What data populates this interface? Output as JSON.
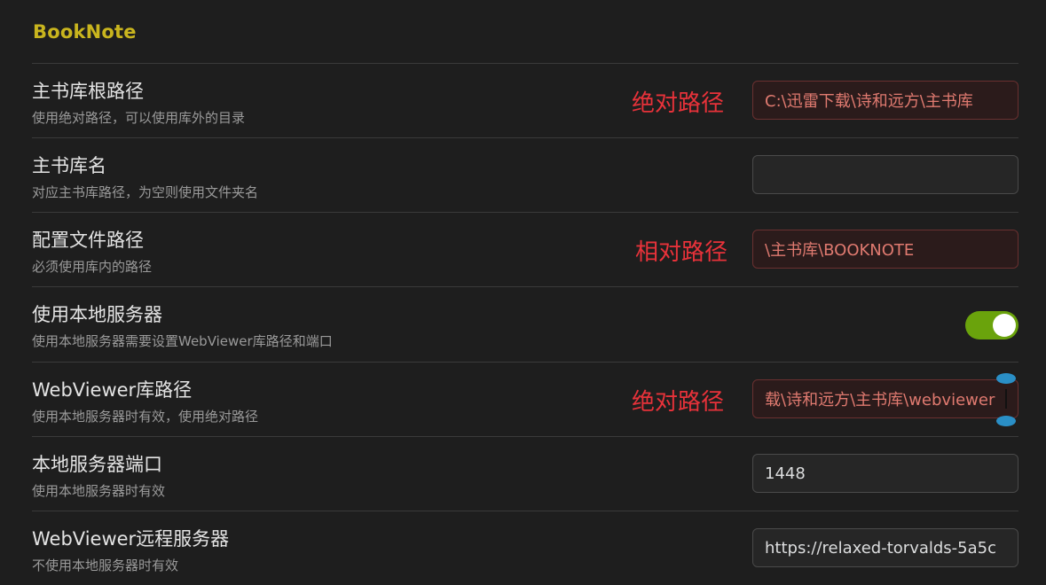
{
  "section": {
    "title": "BookNote"
  },
  "settings": [
    {
      "name": "主书库根路径",
      "desc": "使用绝对路径，可以使用库外的目录",
      "note": "绝对路径",
      "value": "C:\\迅雷下载\\诗和远方\\主书库",
      "placeholder": ""
    },
    {
      "name": "主书库名",
      "desc": "对应主书库路径，为空则使用文件夹名",
      "note": "",
      "value": "",
      "placeholder": ""
    },
    {
      "name": "配置文件路径",
      "desc": "必须使用库内的路径",
      "note": "相对路径",
      "value": "\\主书库\\BOOKNOTE",
      "placeholder": ""
    },
    {
      "name": "使用本地服务器",
      "desc": "使用本地服务器需要设置WebViewer库路径和端口",
      "toggle_on": true
    },
    {
      "name": "WebViewer库路径",
      "desc": "使用本地服务器时有效，使用绝对路径",
      "note": "绝对路径",
      "value": "载\\诗和远方\\主书库\\webviewer",
      "placeholder": ""
    },
    {
      "name": "本地服务器端口",
      "desc": "使用本地服务器时有效",
      "note": "",
      "value": "1448",
      "placeholder": ""
    },
    {
      "name": "WebViewer远程服务器",
      "desc": "不使用本地服务器时有效",
      "note": "",
      "value": "https://relaxed-torvalds-5a5c",
      "placeholder": ""
    }
  ],
  "colors": {
    "accent_title": "#c9b51e",
    "note_red": "#e8323a",
    "toggle_on": "#6aa30c",
    "caret_handle": "#2a8fc6"
  }
}
